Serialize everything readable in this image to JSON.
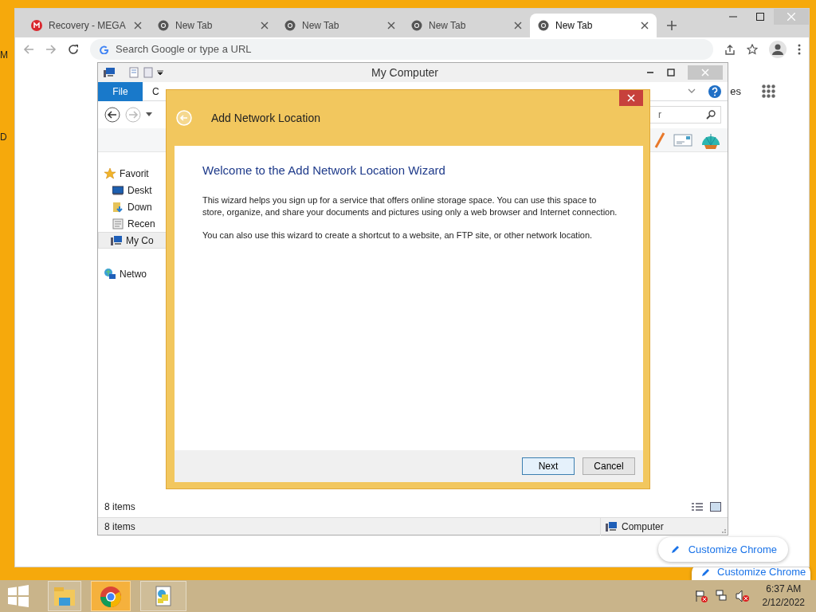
{
  "desktop": {
    "edge_labels": [
      "M",
      "D"
    ]
  },
  "browser": {
    "tabs": [
      {
        "title": "Recovery - MEGA",
        "kind": "mega",
        "selected": false
      },
      {
        "title": "New Tab",
        "kind": "chrome",
        "selected": false
      },
      {
        "title": "New Tab",
        "kind": "chrome",
        "selected": false
      },
      {
        "title": "New Tab",
        "kind": "chrome",
        "selected": false
      },
      {
        "title": "New Tab",
        "kind": "chrome",
        "selected": true
      }
    ],
    "address_placeholder": "Search Google or type a URL",
    "page": {
      "partial_link": "es",
      "customize_button": "Customize Chrome"
    }
  },
  "background_window": {
    "customize_button": "Customize Chrome"
  },
  "explorer": {
    "title": "My Computer",
    "ribbon_tabs": [
      {
        "label": "File",
        "kind": "file"
      },
      {
        "label": "C",
        "kind": "tab"
      }
    ],
    "search_text": "r",
    "nav_items": [
      {
        "label": "Favorit",
        "kind": "star",
        "selected": false,
        "children": [
          {
            "label": "Deskt",
            "kind": "desktop",
            "selected": false
          },
          {
            "label": "Down",
            "kind": "downloads",
            "selected": false
          },
          {
            "label": "Recen",
            "kind": "recent",
            "selected": false
          }
        ]
      },
      {
        "label": "My Co",
        "kind": "computer",
        "selected": true
      },
      {
        "label": "Netwo",
        "kind": "network",
        "selected": false
      }
    ],
    "content_status": "8 items",
    "status_bar": {
      "count": "8 items",
      "location": "Computer"
    }
  },
  "wizard": {
    "title": "Add Network Location",
    "heading": "Welcome to the Add Network Location Wizard",
    "paragraphs": [
      "This wizard helps you sign up for a service that offers online storage space. You can use this space to store, organize, and share your documents and pictures using only a web browser and Internet connection.",
      "You can also use this wizard to create a shortcut to a website, an FTP site, or other network location."
    ],
    "buttons": [
      {
        "label": "Next",
        "default": true
      },
      {
        "label": "Cancel",
        "default": false
      }
    ]
  },
  "taskbar": {
    "apps": [
      {
        "kind": "explorer",
        "active": false
      },
      {
        "kind": "chrome",
        "active": true
      },
      {
        "kind": "network",
        "active": false
      }
    ],
    "time": "6:37 AM",
    "date": "2/12/2022"
  }
}
